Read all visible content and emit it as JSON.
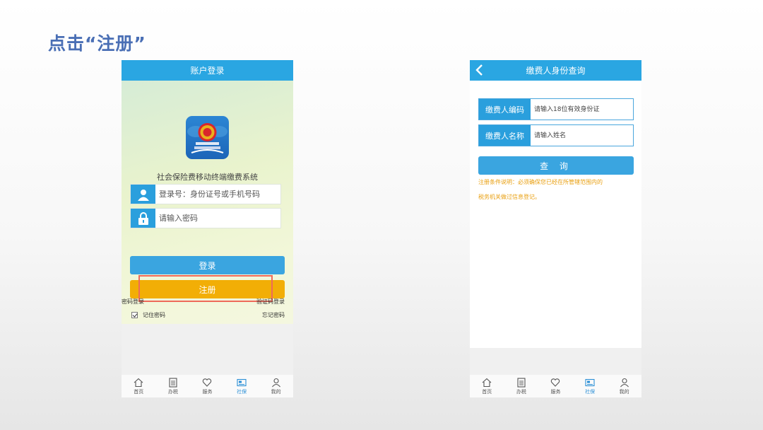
{
  "slide": {
    "title": "点击“注册”"
  },
  "login_screen": {
    "header_title": "账户登录",
    "app_name": "社会保险费移动终端缴费系统",
    "username_placeholder": "登录号：身份证号或手机号码",
    "password_placeholder": "请输入密码",
    "login_button": "登录",
    "register_button": "注册",
    "password_login_link": "密码登录",
    "sms_login_link": "验证码登录",
    "remember_password": "记住密码",
    "remember_checked": true,
    "forgot_password": "忘记密码"
  },
  "query_screen": {
    "header_title": "缴费人身份查询",
    "payer_id_label": "缴费人编码",
    "payer_id_placeholder": "请输入18位有效身份证",
    "payer_name_label": "缴费人名称",
    "payer_name_placeholder": "请输入姓名",
    "query_button": "查 询",
    "note_line1": "注册条件说明：必须确保您已经在所管辖范围内的",
    "note_line2": "税务机关做过信息登记。"
  },
  "tabbar": {
    "items": [
      {
        "label": "首页",
        "icon": "home-icon"
      },
      {
        "label": "办税",
        "icon": "document-icon"
      },
      {
        "label": "服务",
        "icon": "heart-icon"
      },
      {
        "label": "社保",
        "icon": "social-security-card-icon"
      },
      {
        "label": "我的",
        "icon": "user-icon"
      }
    ],
    "active_index": 3
  },
  "colors": {
    "title": "#4a6fb5",
    "header_blue": "#2aa6e2",
    "login_button": "#3aa5e0",
    "register_button": "#f2ae06",
    "highlight": "#ee6a5a",
    "note_text": "#e9a012"
  }
}
